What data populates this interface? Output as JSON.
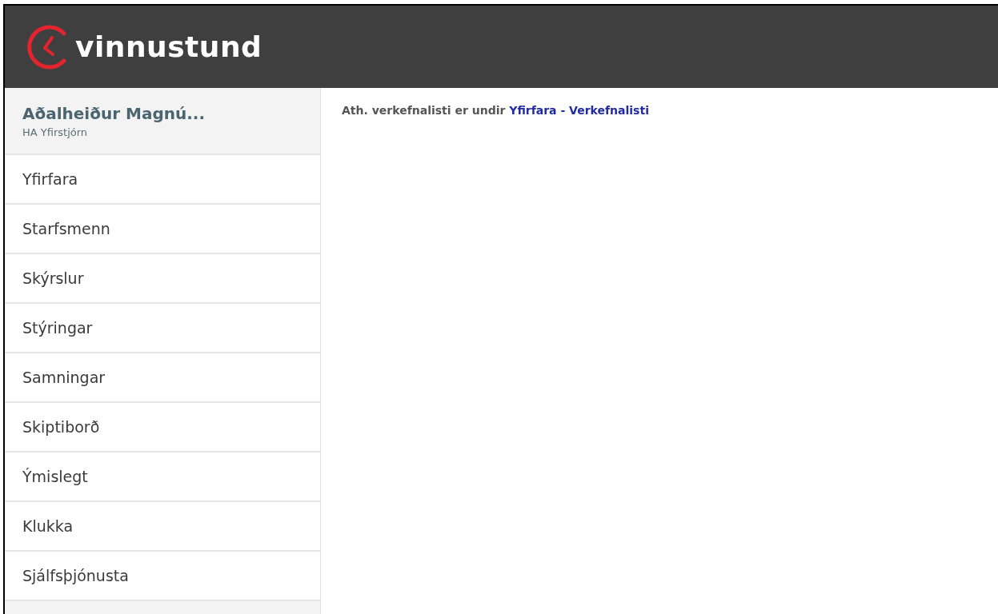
{
  "header": {
    "logo_text": "vinnustund"
  },
  "user": {
    "name": "Aðalheiður Magnú...",
    "role": "HA Yfirstjórn"
  },
  "menu": [
    {
      "label": "Yfirfara"
    },
    {
      "label": "Starfsmenn"
    },
    {
      "label": "Skýrslur"
    },
    {
      "label": "Stýringar"
    },
    {
      "label": "Samningar"
    },
    {
      "label": "Skiptiborð"
    },
    {
      "label": "Ýmislegt"
    },
    {
      "label": "Klukka"
    },
    {
      "label": "Sjálfsþjónusta"
    }
  ],
  "notice": {
    "text": "Ath. verkefnalisti er undir",
    "link": "Yfirfara - Verkefnalisti"
  }
}
